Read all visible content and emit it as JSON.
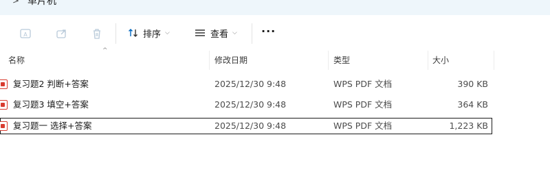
{
  "address": {
    "breadcrumb": "单片机"
  },
  "toolbar": {
    "sort_label": "排序",
    "view_label": "查看",
    "more_label": "···"
  },
  "columns": {
    "name": "名称",
    "modified": "修改日期",
    "type": "类型",
    "size": "大小"
  },
  "files": [
    {
      "name": "复习题2  判断+答案",
      "modified": "2025/12/30 9:48",
      "type": "WPS PDF 文档",
      "size": "390 KB",
      "selected": false
    },
    {
      "name": "复习题3   填空+答案",
      "modified": "2025/12/30 9:48",
      "type": "WPS PDF 文档",
      "size": "364 KB",
      "selected": false
    },
    {
      "name": "复习题一  选择+答案",
      "modified": "2025/12/30 9:48",
      "type": "WPS PDF 文档",
      "size": "1,223 KB",
      "selected": true
    }
  ],
  "colors": {
    "accent": "#0067c0",
    "pdf": "#d83b2f",
    "address_bg": "#eef6fb"
  }
}
